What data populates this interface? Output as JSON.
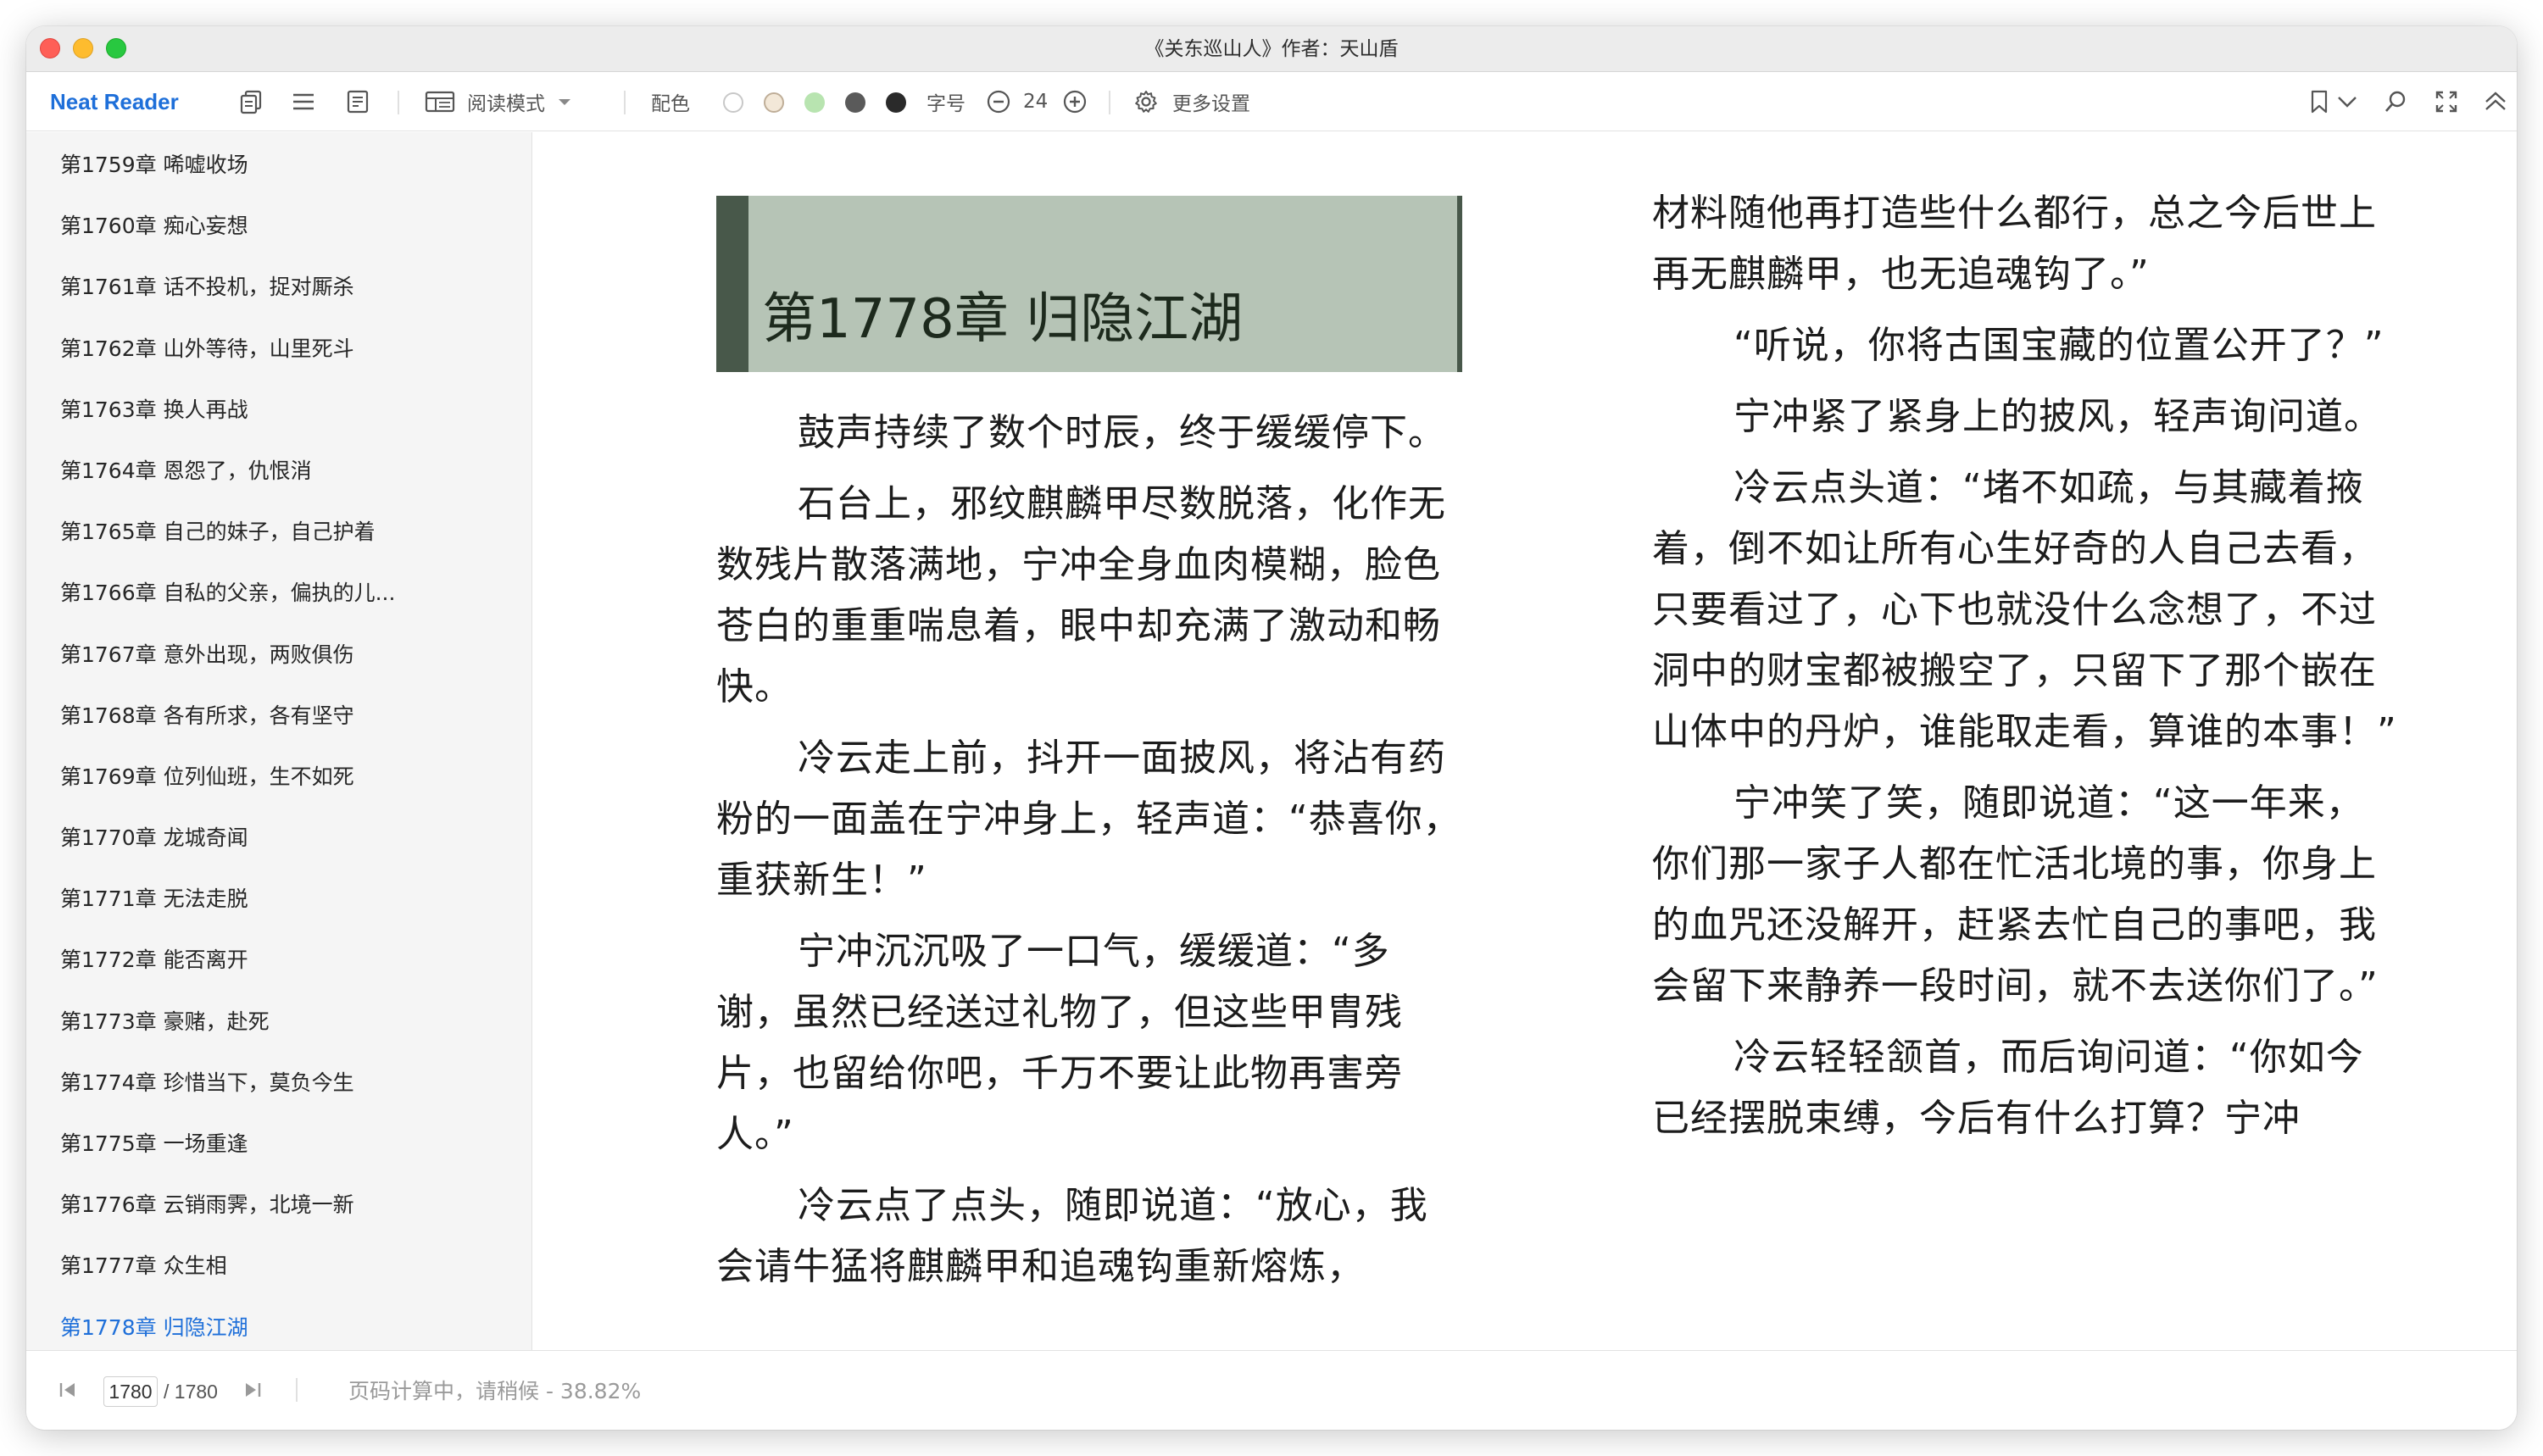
{
  "window": {
    "title": "《关东巡山人》作者：天山盾"
  },
  "toolbar": {
    "brand": "Neat Reader",
    "reading_mode_label": "阅读模式",
    "color_scheme_label": "配色",
    "font_size_label": "字号",
    "font_size_value": "24",
    "more_settings_label": "更多设置",
    "color_swatches": [
      "#ffffff",
      "#f3e8d8",
      "#b8e4b0",
      "#5a5a5a",
      "#2a2a2a"
    ]
  },
  "sidebar": {
    "items": [
      {
        "label": "第1759章 唏嘘收场"
      },
      {
        "label": "第1760章 痴心妄想"
      },
      {
        "label": "第1761章 话不投机，捉对厮杀"
      },
      {
        "label": "第1762章 山外等待，山里死斗"
      },
      {
        "label": "第1763章 换人再战"
      },
      {
        "label": "第1764章 恩怨了，仇恨消"
      },
      {
        "label": "第1765章 自己的妹子，自己护着"
      },
      {
        "label": "第1766章 自私的父亲，偏执的儿..."
      },
      {
        "label": "第1767章 意外出现，两败俱伤"
      },
      {
        "label": "第1768章 各有所求，各有坚守"
      },
      {
        "label": "第1769章 位列仙班，生不如死"
      },
      {
        "label": "第1770章 龙城奇闻"
      },
      {
        "label": "第1771章 无法走脱"
      },
      {
        "label": "第1772章 能否离开"
      },
      {
        "label": "第1773章 豪赌，赴死"
      },
      {
        "label": "第1774章 珍惜当下，莫负今生"
      },
      {
        "label": "第1775章 一场重逢"
      },
      {
        "label": "第1776章 云销雨霁，北境一新"
      },
      {
        "label": "第1777章 众生相"
      },
      {
        "label": "第1778章 归隐江湖"
      }
    ]
  },
  "content": {
    "chapter_title": "第1778章 归隐江湖",
    "left_paragraphs": [
      {
        "text": "鼓声持续了数个时辰，终于缓缓停下。"
      },
      {
        "text": "石台上，邪纹麒麟甲尽数脱落，化作无数残片散落满地，宁冲全身血肉模糊，脸色苍白的重重喘息着，眼中却充满了激动和畅快。"
      },
      {
        "text": "冷云走上前，抖开一面披风，将沾有药粉的一面盖在宁冲身上，轻声道：“恭喜你，重获新生！”"
      },
      {
        "text": "宁冲沉沉吸了一口气，缓缓道：“多谢，虽然已经送过礼物了，但这些甲胄残片，也留给你吧，千万不要让此物再害旁人。”"
      },
      {
        "text": "冷云点了点头，随即说道：“放心，我会请牛猛将麒麟甲和追魂钩重新熔炼，"
      }
    ],
    "right_continuation": "材料随他再打造些什么都行，总之今后世上再无麒麟甲，也无追魂钩了。”",
    "right_paragraphs": [
      {
        "text": "“听说，你将古国宝藏的位置公开了？”"
      },
      {
        "text": "宁冲紧了紧身上的披风，轻声询问道。"
      },
      {
        "text": "冷云点头道：“堵不如疏，与其藏着掖着，倒不如让所有心生好奇的人自己去看，只要看过了，心下也就没什么念想了，不过洞中的财宝都被搬空了，只留下了那个嵌在山体中的丹炉，谁能取走看，算谁的本事！”"
      },
      {
        "text": "宁冲笑了笑，随即说道：“这一年来，你们那一家子人都在忙活北境的事，你身上的血咒还没解开，赶紧去忙自己的事吧，我会留下来静养一段时间，就不去送你们了。”"
      },
      {
        "text": "冷云轻轻颔首，而后询问道：“你如今已经摆脱束缚，今后有什么打算？宁冲"
      }
    ]
  },
  "statusbar": {
    "current_page": "1780",
    "total_pages": "/ 1780",
    "progress_text": "页码计算中，请稍候 - 38.82%"
  }
}
